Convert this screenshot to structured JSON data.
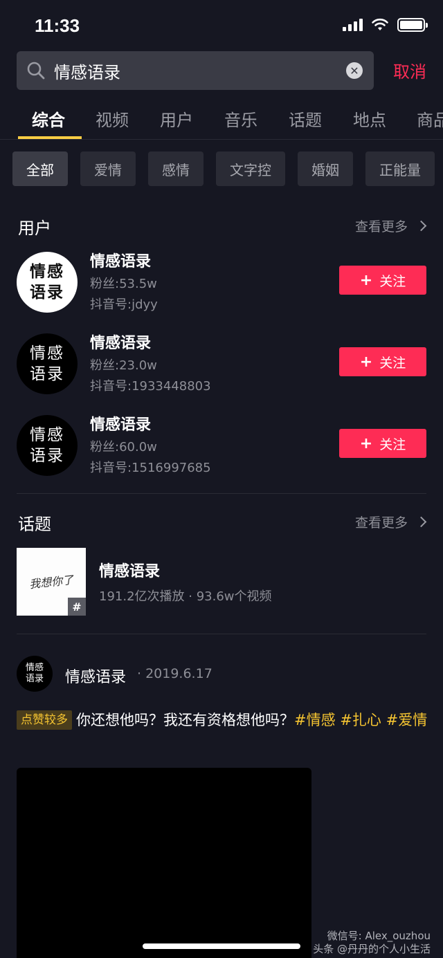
{
  "status_bar": {
    "time": "11:33"
  },
  "search": {
    "query": "情感语录",
    "cancel_label": "取消"
  },
  "tabs": [
    "综合",
    "视频",
    "用户",
    "音乐",
    "话题",
    "地点",
    "商品"
  ],
  "chips": [
    "全部",
    "爱情",
    "感情",
    "文字控",
    "婚姻",
    "正能量"
  ],
  "users_section": {
    "title": "用户",
    "see_more": "查看更多",
    "users": [
      {
        "name": "情感语录",
        "fans": "粉丝:53.5w",
        "id": "抖音号:jdyy",
        "avatar_text": "情感语录",
        "follow_label": "关注"
      },
      {
        "name": "情感语录",
        "fans": "粉丝:23.0w",
        "id": "抖音号:1933448803",
        "avatar_text": "情感语录",
        "follow_label": "关注"
      },
      {
        "name": "情感语录",
        "fans": "粉丝:60.0w",
        "id": "抖音号:1516997685",
        "avatar_text": "情感语录",
        "follow_label": "关注"
      }
    ]
  },
  "topics_section": {
    "title": "话题",
    "see_more": "查看更多",
    "topic": {
      "name": "情感语录",
      "stats": "191.2亿次播放 · 93.6w个视频",
      "thumb_text": "我想你了",
      "hash": "#"
    }
  },
  "post": {
    "author": "情感语录",
    "date": "· 2019.6.17",
    "avatar_text": "情感语录",
    "badge": "点赞较多",
    "text": "你还想他吗？我还有资格想他吗？",
    "tags": [
      "#情感",
      "#扎心",
      "#爱情"
    ]
  },
  "watermark": {
    "line1": "微信号: Alex_ouzhou",
    "line2": "头条 @丹丹的个人小生活"
  },
  "colors": {
    "accent": "#fe2c55",
    "tab_underline": "#facd44",
    "tag": "#f5c431",
    "background": "#161722"
  }
}
